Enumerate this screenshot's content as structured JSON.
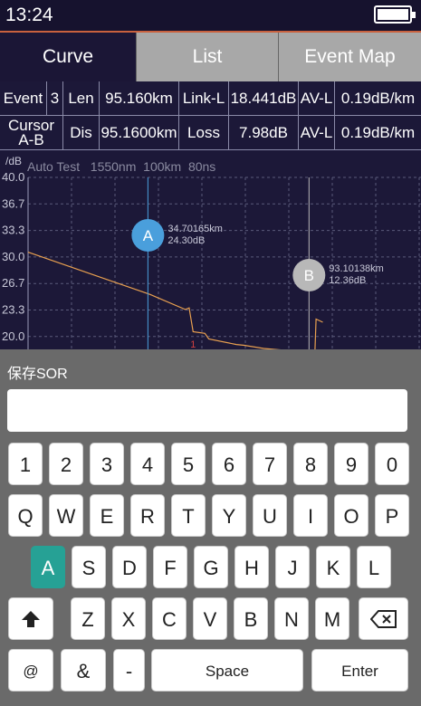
{
  "status": {
    "time": "13:24"
  },
  "tabs": [
    {
      "label": "Curve",
      "active": true
    },
    {
      "label": "List",
      "active": false
    },
    {
      "label": "Event Map",
      "active": false
    }
  ],
  "info": {
    "event_label": "Event",
    "event_value": "3",
    "len_label": "Len",
    "len_value": "95.160km",
    "linkl_label": "Link-L",
    "linkl_value": "18.441dB",
    "avl_label": "AV-L",
    "avl_value": "0.19dB/km",
    "cursor_label_line1": "Cursor",
    "cursor_label_line2": "A-B",
    "dis_label": "Dis",
    "dis_value": "95.1600km",
    "loss_label": "Loss",
    "loss_value": "7.98dB",
    "avl2_label": "AV-L",
    "avl2_value": "0.19dB/km"
  },
  "chart_data": {
    "type": "line",
    "y_unit_label": "/dB",
    "header": "Auto Test   1550nm  100km  80ns",
    "y_ticks": [
      "40.0",
      "36.7",
      "33.3",
      "30.0",
      "26.7",
      "23.3",
      "20.0"
    ],
    "ylim": [
      18.5,
      40.0
    ],
    "xlim": [
      0,
      100
    ],
    "grid": true,
    "series": [
      {
        "x": [
          0,
          31,
          40,
          41,
          42,
          45,
          46,
          53,
          55,
          60,
          65,
          71,
          73,
          73.3,
          75
        ],
        "y": [
          30.6,
          25.3,
          23.4,
          23.6,
          20.6,
          20.4,
          19.7,
          19.0,
          18.9,
          18.5,
          18.3,
          18.1,
          18.0,
          22.2,
          21.8
        ]
      }
    ],
    "cursors": [
      {
        "label": "A",
        "x": 30.5,
        "distance": "34.70165km",
        "loss": "24.30dB",
        "color": "#4a9fdc"
      },
      {
        "label": "B",
        "x": 71.5,
        "distance": "93.10138km",
        "loss": "12.36dB",
        "color": "#b8b8b8"
      }
    ],
    "events": [
      {
        "label": "1",
        "x": 42,
        "y": 20.0
      }
    ],
    "colors": {
      "trace": "#e8a050",
      "grid": "#5a5a7a",
      "event": "#d04040"
    }
  },
  "keyboard": {
    "title": "保存SOR",
    "input_value": "",
    "row1": [
      "1",
      "2",
      "3",
      "4",
      "5",
      "6",
      "7",
      "8",
      "9",
      "0"
    ],
    "row2": [
      "Q",
      "W",
      "E",
      "R",
      "T",
      "Y",
      "U",
      "I",
      "O",
      "P"
    ],
    "row3": [
      "A",
      "S",
      "D",
      "F",
      "G",
      "H",
      "J",
      "K",
      "L"
    ],
    "row4": [
      "Z",
      "X",
      "C",
      "V",
      "B",
      "N",
      "M"
    ],
    "active_key": "A",
    "shift_icon": "shift-up-arrow-icon",
    "backspace_icon": "backspace-icon",
    "at": "@",
    "amp": "&",
    "dash": "-",
    "space": "Space",
    "enter": "Enter",
    "accent": "#26a195"
  }
}
